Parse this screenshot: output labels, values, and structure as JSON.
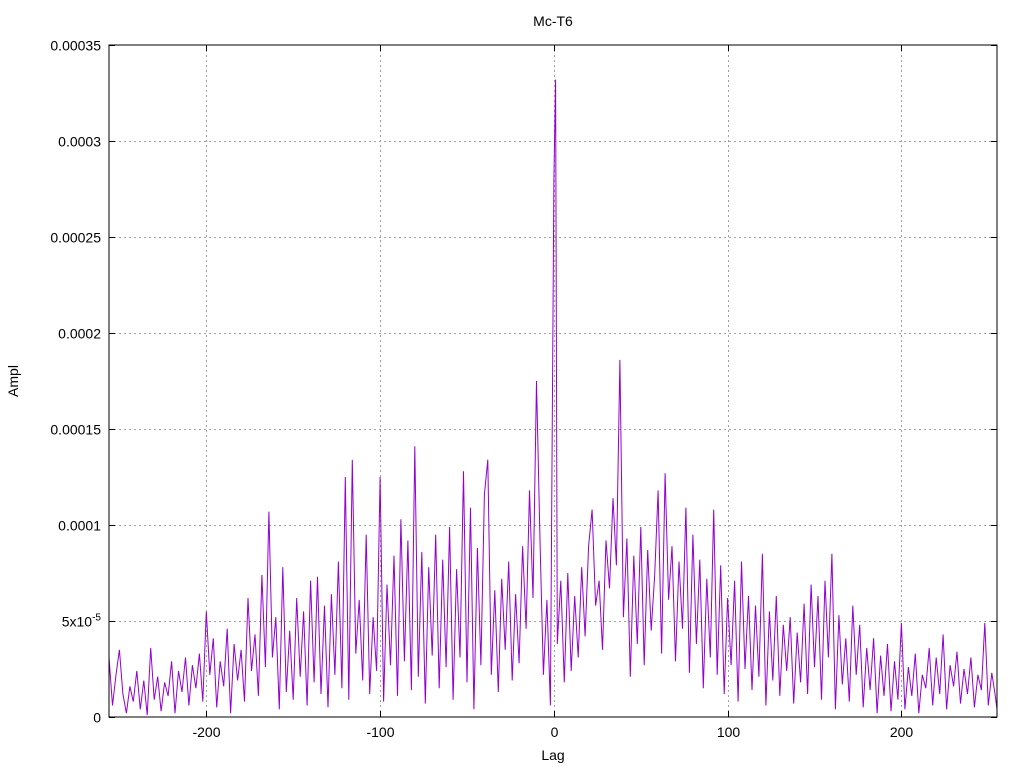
{
  "chart_data": {
    "type": "line",
    "title": "Mc-T6",
    "xlabel": "Lag",
    "ylabel": "Ampl",
    "xlim": [
      -256,
      255
    ],
    "ylim": [
      0,
      0.00035
    ],
    "grid": true,
    "legend": "none",
    "x_ticks": [
      {
        "value": -200,
        "label": "-200"
      },
      {
        "value": -100,
        "label": "-100"
      },
      {
        "value": 0,
        "label": "0"
      },
      {
        "value": 100,
        "label": "100"
      },
      {
        "value": 200,
        "label": "200"
      }
    ],
    "y_ticks": [
      {
        "value": 0,
        "label": "0"
      },
      {
        "value": 5e-05,
        "label": "5x10",
        "sup": "-5"
      },
      {
        "value": 0.0001,
        "label": "0.0001"
      },
      {
        "value": 0.00015,
        "label": "0.00015"
      },
      {
        "value": 0.0002,
        "label": "0.0002"
      },
      {
        "value": 0.00025,
        "label": "0.00025"
      },
      {
        "value": 0.0003,
        "label": "0.0003"
      },
      {
        "value": 0.00035,
        "label": "0.00035"
      }
    ],
    "series": [
      {
        "color": "#9400d3",
        "points": [
          [
            -256,
            3.1e-05
          ],
          [
            -254,
            6e-06
          ],
          [
            -252,
            2.2e-05
          ],
          [
            -250,
            3.5e-05
          ],
          [
            -248,
            1.2e-05
          ],
          [
            -246,
            2e-06
          ],
          [
            -244,
            1.6e-05
          ],
          [
            -242,
            8e-06
          ],
          [
            -240,
            2.4e-05
          ],
          [
            -238,
            4e-06
          ],
          [
            -236,
            1.9e-05
          ],
          [
            -234,
            1e-06
          ],
          [
            -232,
            3.6e-05
          ],
          [
            -230,
            9e-06
          ],
          [
            -228,
            2.1e-05
          ],
          [
            -226,
            3e-06
          ],
          [
            -224,
            1.8e-05
          ],
          [
            -222,
            1.1e-05
          ],
          [
            -220,
            2.9e-05
          ],
          [
            -218,
            2e-06
          ],
          [
            -216,
            2.4e-05
          ],
          [
            -214,
            1.3e-05
          ],
          [
            -212,
            3.1e-05
          ],
          [
            -210,
            6e-06
          ],
          [
            -208,
            2.7e-05
          ],
          [
            -206,
            1.5e-05
          ],
          [
            -204,
            3.3e-05
          ],
          [
            -202,
            8e-06
          ],
          [
            -200,
            5.5e-05
          ],
          [
            -198,
            2.2e-05
          ],
          [
            -196,
            4.1e-05
          ],
          [
            -194,
            5e-06
          ],
          [
            -192,
            2.9e-05
          ],
          [
            -190,
            1.6e-05
          ],
          [
            -188,
            4.6e-05
          ],
          [
            -186,
            2e-06
          ],
          [
            -184,
            3.8e-05
          ],
          [
            -182,
            1.9e-05
          ],
          [
            -180,
            3.5e-05
          ],
          [
            -178,
            8e-06
          ],
          [
            -176,
            6.2e-05
          ],
          [
            -174,
            2.4e-05
          ],
          [
            -172,
            4.3e-05
          ],
          [
            -170,
            1.1e-05
          ],
          [
            -168,
            7.4e-05
          ],
          [
            -166,
            2.6e-05
          ],
          [
            -164,
            0.000107
          ],
          [
            -162,
            3.1e-05
          ],
          [
            -160,
            5.2e-05
          ],
          [
            -158,
            4e-06
          ],
          [
            -156,
            7.8e-05
          ],
          [
            -154,
            1.3e-05
          ],
          [
            -152,
            4.5e-05
          ],
          [
            -150,
            9e-06
          ],
          [
            -148,
            6.2e-05
          ],
          [
            -146,
            2.1e-05
          ],
          [
            -144,
            5.5e-05
          ],
          [
            -142,
            6e-06
          ],
          [
            -140,
            7.1e-05
          ],
          [
            -138,
            1.8e-05
          ],
          [
            -136,
            7.3e-05
          ],
          [
            -134,
            1.2e-05
          ],
          [
            -132,
            5.8e-05
          ],
          [
            -130,
            5e-06
          ],
          [
            -128,
            6.4e-05
          ],
          [
            -126,
            2.2e-05
          ],
          [
            -124,
            8.1e-05
          ],
          [
            -122,
            1.5e-05
          ],
          [
            -120,
            0.000125
          ],
          [
            -118,
            9e-06
          ],
          [
            -116,
            0.000134
          ],
          [
            -114,
            3.3e-05
          ],
          [
            -112,
            6.1e-05
          ],
          [
            -110,
            1.9e-05
          ],
          [
            -108,
            9.5e-05
          ],
          [
            -106,
            1.2e-05
          ],
          [
            -104,
            5.2e-05
          ],
          [
            -102,
            2.4e-05
          ],
          [
            -100,
            0.000125
          ],
          [
            -98,
            8e-06
          ],
          [
            -96,
            6.9e-05
          ],
          [
            -94,
            2.7e-05
          ],
          [
            -92,
            8.4e-05
          ],
          [
            -90,
            1.1e-05
          ],
          [
            -88,
            0.000103
          ],
          [
            -86,
            2.9e-05
          ],
          [
            -84,
            9.2e-05
          ],
          [
            -82,
            1.4e-05
          ],
          [
            -80,
            0.000141
          ],
          [
            -78,
            2.1e-05
          ],
          [
            -76,
            8.6e-05
          ],
          [
            -74,
            7e-06
          ],
          [
            -72,
            7.8e-05
          ],
          [
            -70,
            3.2e-05
          ],
          [
            -68,
            9.5e-05
          ],
          [
            -66,
            1.5e-05
          ],
          [
            -64,
            8.2e-05
          ],
          [
            -62,
            2.6e-05
          ],
          [
            -60,
            9.9e-05
          ],
          [
            -58,
            9e-06
          ],
          [
            -56,
            7.7e-05
          ],
          [
            -54,
            3.1e-05
          ],
          [
            -52,
            0.000128
          ],
          [
            -50,
            1.8e-05
          ],
          [
            -48,
            0.000109
          ],
          [
            -46,
            4e-06
          ],
          [
            -44,
            8.8e-05
          ],
          [
            -42,
            2.7e-05
          ],
          [
            -40,
            0.000116
          ],
          [
            -38,
            0.000134
          ],
          [
            -36,
            2.2e-05
          ],
          [
            -34,
            6.6e-05
          ],
          [
            -32,
            1.3e-05
          ],
          [
            -30,
            7.2e-05
          ],
          [
            -28,
            3.5e-05
          ],
          [
            -26,
            8.1e-05
          ],
          [
            -24,
            1.9e-05
          ],
          [
            -22,
            6.4e-05
          ],
          [
            -20,
            2.8e-05
          ],
          [
            -18,
            8.9e-05
          ],
          [
            -16,
            4.6e-05
          ],
          [
            -14,
            0.000118
          ],
          [
            -12,
            6.2e-05
          ],
          [
            -10,
            0.000175
          ],
          [
            -8,
            9.2e-05
          ],
          [
            -6,
            2.2e-05
          ],
          [
            -4,
            6.1e-05
          ],
          [
            -2,
            6e-06
          ],
          [
            0,
            0.00028
          ],
          [
            1,
            0.000332
          ],
          [
            2,
            3.8e-05
          ],
          [
            4,
            7.1e-05
          ],
          [
            6,
            1.8e-05
          ],
          [
            8,
            7.5e-05
          ],
          [
            10,
            2.4e-05
          ],
          [
            12,
            6.3e-05
          ],
          [
            14,
            3.1e-05
          ],
          [
            16,
            7.8e-05
          ],
          [
            18,
            4.2e-05
          ],
          [
            20,
            8.9e-05
          ],
          [
            22,
            0.000108
          ],
          [
            24,
            5.8e-05
          ],
          [
            26,
            7.1e-05
          ],
          [
            28,
            3.5e-05
          ],
          [
            30,
            9.2e-05
          ],
          [
            32,
            6.7e-05
          ],
          [
            34,
            0.000114
          ],
          [
            36,
            7.9e-05
          ],
          [
            38,
            0.000186
          ],
          [
            40,
            5.2e-05
          ],
          [
            42,
            9.3e-05
          ],
          [
            44,
            2.1e-05
          ],
          [
            46,
            8.4e-05
          ],
          [
            48,
            3.8e-05
          ],
          [
            50,
            9.9e-05
          ],
          [
            52,
            2.7e-05
          ],
          [
            54,
            8.7e-05
          ],
          [
            56,
            4.5e-05
          ],
          [
            58,
            7.4e-05
          ],
          [
            60,
            0.000118
          ],
          [
            62,
            3.3e-05
          ],
          [
            64,
            0.000127
          ],
          [
            66,
            6.1e-05
          ],
          [
            68,
            8.9e-05
          ],
          [
            70,
            2.9e-05
          ],
          [
            72,
            8.1e-05
          ],
          [
            74,
            4.6e-05
          ],
          [
            76,
            0.000109
          ],
          [
            78,
            2.3e-05
          ],
          [
            80,
            9.5e-05
          ],
          [
            82,
            3.8e-05
          ],
          [
            84,
            8.2e-05
          ],
          [
            86,
            1.5e-05
          ],
          [
            88,
            7.2e-05
          ],
          [
            90,
            3.1e-05
          ],
          [
            92,
            0.000108
          ],
          [
            94,
            2.2e-05
          ],
          [
            96,
            7.9e-05
          ],
          [
            98,
            1.2e-05
          ],
          [
            100,
            6.2e-05
          ],
          [
            102,
            2.7e-05
          ],
          [
            104,
            7.1e-05
          ],
          [
            106,
            8e-06
          ],
          [
            108,
            8.1e-05
          ],
          [
            110,
            2.5e-05
          ],
          [
            112,
            6.3e-05
          ],
          [
            114,
            1.4e-05
          ],
          [
            116,
            5.8e-05
          ],
          [
            118,
            2.1e-05
          ],
          [
            120,
            8.5e-05
          ],
          [
            122,
            6e-06
          ],
          [
            124,
            5.5e-05
          ],
          [
            126,
            1.9e-05
          ],
          [
            128,
            6.3e-05
          ],
          [
            130,
            1.1e-05
          ],
          [
            132,
            4.8e-05
          ],
          [
            134,
            2.4e-05
          ],
          [
            136,
            5.2e-05
          ],
          [
            138,
            7e-06
          ],
          [
            140,
            4.4e-05
          ],
          [
            142,
            1.8e-05
          ],
          [
            144,
            5.9e-05
          ],
          [
            146,
            1.2e-05
          ],
          [
            148,
            6.9e-05
          ],
          [
            150,
            2.6e-05
          ],
          [
            152,
            6.3e-05
          ],
          [
            154,
            9e-06
          ],
          [
            156,
            7.1e-05
          ],
          [
            158,
            3.1e-05
          ],
          [
            160,
            8.5e-05
          ],
          [
            162,
            4e-06
          ],
          [
            164,
            5.3e-05
          ],
          [
            166,
            1.7e-05
          ],
          [
            168,
            4.1e-05
          ],
          [
            170,
            8e-06
          ],
          [
            172,
            5.8e-05
          ],
          [
            174,
            2.2e-05
          ],
          [
            176,
            4.8e-05
          ],
          [
            178,
            5e-06
          ],
          [
            180,
            3.6e-05
          ],
          [
            182,
            1.4e-05
          ],
          [
            184,
            4.1e-05
          ],
          [
            186,
            2e-06
          ],
          [
            188,
            3.2e-05
          ],
          [
            190,
            1.1e-05
          ],
          [
            192,
            3.8e-05
          ],
          [
            194,
            3e-06
          ],
          [
            196,
            2.9e-05
          ],
          [
            198,
            9e-06
          ],
          [
            200,
            4.9e-05
          ],
          [
            202,
            4e-06
          ],
          [
            204,
            2.6e-05
          ],
          [
            206,
            1.1e-05
          ],
          [
            208,
            3.3e-05
          ],
          [
            210,
            2e-06
          ],
          [
            212,
            2.2e-05
          ],
          [
            214,
            1.5e-05
          ],
          [
            216,
            3.6e-05
          ],
          [
            218,
            6e-06
          ],
          [
            220,
            3.1e-05
          ],
          [
            222,
            1.2e-05
          ],
          [
            224,
            4.3e-05
          ],
          [
            226,
            4e-06
          ],
          [
            228,
            2.7e-05
          ],
          [
            230,
            1.6e-05
          ],
          [
            232,
            3.4e-05
          ],
          [
            234,
            7e-06
          ],
          [
            236,
            2.5e-05
          ],
          [
            238,
            1.2e-05
          ],
          [
            240,
            3.1e-05
          ],
          [
            242,
            5e-06
          ],
          [
            244,
            2.2e-05
          ],
          [
            246,
            1.4e-05
          ],
          [
            248,
            4.9e-05
          ],
          [
            250,
            6e-06
          ],
          [
            252,
            2.3e-05
          ],
          [
            254,
            1.1e-05
          ],
          [
            255,
            4e-06
          ]
        ]
      }
    ]
  }
}
